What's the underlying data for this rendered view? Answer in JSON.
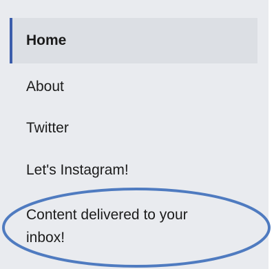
{
  "nav": {
    "items": [
      {
        "label": "Home",
        "active": true
      },
      {
        "label": "About"
      },
      {
        "label": "Twitter"
      },
      {
        "label": "Let's Instagram!"
      },
      {
        "label": "Content delivered to your inbox!"
      }
    ]
  },
  "colors": {
    "panel_bg": "#e9ebef",
    "active_bg": "#dcdfe4",
    "active_indicator": "#3b5dab",
    "highlight_ring": "#4f7bc0"
  }
}
